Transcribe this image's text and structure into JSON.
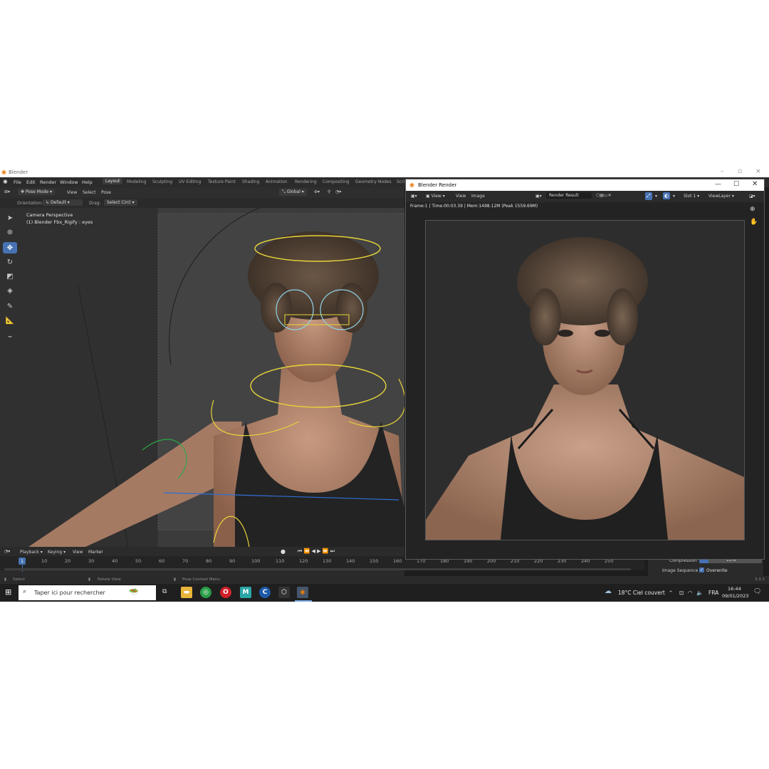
{
  "app": {
    "title": "Blender",
    "version": "3.3.1"
  },
  "menu": [
    "File",
    "Edit",
    "Render",
    "Window",
    "Help"
  ],
  "workspaces": [
    "Layout",
    "Modeling",
    "Sculpting",
    "UV Editing",
    "Texture Paint",
    "Shading",
    "Animation",
    "Rendering",
    "Compositing",
    "Geometry Nodes",
    "Scri"
  ],
  "viewport_header": {
    "mode": "Pose Mode",
    "view": "View",
    "select": "Select",
    "pose": "Pose",
    "transform": "Global"
  },
  "tool_settings": {
    "orientation_label": "Orientation:",
    "orientation_value": "Default",
    "drag_label": "Drag:",
    "drag_value": "Select Circl"
  },
  "viewport": {
    "camera_label": "Camera Perspective",
    "object_label": "(1) Blender Fbx_Rigify : eyes"
  },
  "render_window": {
    "title": "Blender Render",
    "view": "View",
    "view2": "View",
    "image": "Image",
    "result": "Render Result",
    "slot": "Slot 1",
    "viewlayer": "ViewLayer",
    "info": "Frame:1 | Time:00:03.39 | Mem:1498.12M (Peak 1559.69M)"
  },
  "timeline": {
    "playback": "Playback",
    "keying": "Keying",
    "view": "View",
    "marker": "Marker",
    "current_frame": "1",
    "ticks": [
      "10",
      "20",
      "30",
      "40",
      "50",
      "60",
      "70",
      "80",
      "90",
      "100",
      "110",
      "120",
      "130",
      "140",
      "150",
      "160",
      "170",
      "180",
      "190",
      "200",
      "210",
      "220",
      "230",
      "240",
      "250"
    ]
  },
  "properties": {
    "compression_label": "Compression",
    "compression_value": "15%",
    "compression_fraction": 0.15,
    "image_sequence_label": "Image Sequence",
    "overwrite_label": "Overwrite"
  },
  "statusbar": {
    "select": "Select",
    "rotate": "Rotate View",
    "context": "Pose Context Menu"
  },
  "taskbar": {
    "search_placeholder": "Taper ici pour rechercher",
    "weather": "18°C  Ciel couvert",
    "language": "FRA",
    "time": "16:44",
    "date": "09/01/2023"
  },
  "colors": {
    "accent": "#4772b3",
    "rig_yellow": "#e6d43a",
    "rig_cyan": "#8fd3e8"
  },
  "icons": [
    "blender-logo-icon",
    "cursor-icon",
    "move-icon",
    "rotate-icon",
    "scale-icon",
    "transform-icon",
    "annotate-icon",
    "measure-icon",
    "zoom-icon",
    "hand-icon",
    "windows-start-icon",
    "search-icon",
    "explorer-icon",
    "chrome-icon",
    "opera-icon",
    "maya-icon",
    "c-app-icon",
    "box-app-icon",
    "blender-app-icon",
    "notification-icon"
  ]
}
